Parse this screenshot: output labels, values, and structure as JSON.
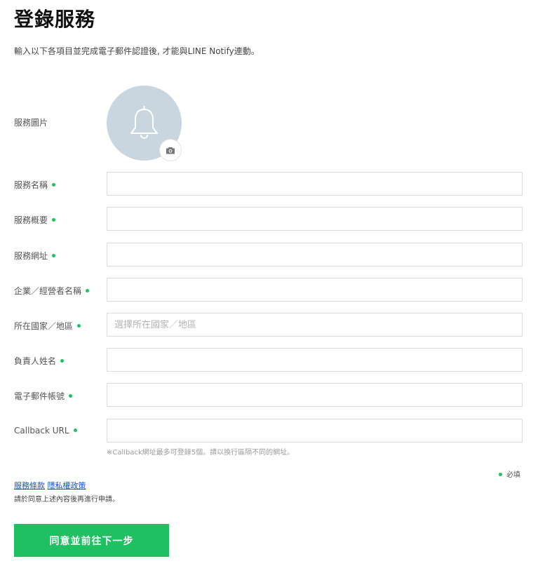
{
  "page": {
    "title": "登錄服務",
    "subtitle": "輸入以下各項目並完成電子郵件認證後, 才能與LINE Notify連動。"
  },
  "colors": {
    "accent": "#1ec061",
    "required_dot": "#1ec061",
    "avatar_bg": "#c9d6df",
    "link": "#1155cc"
  },
  "avatar": {
    "label": "服務圖片",
    "placeholder_icon": "bell-icon",
    "action_icon": "camera-icon"
  },
  "form": {
    "fields": [
      {
        "label": "服務名稱",
        "value": "",
        "placeholder": ""
      },
      {
        "label": "服務概要",
        "value": "",
        "placeholder": ""
      },
      {
        "label": "服務網址",
        "value": "",
        "placeholder": ""
      },
      {
        "label": "企業／經營者名稱",
        "value": "",
        "placeholder": ""
      },
      {
        "label": "所在國家／地區",
        "value": "",
        "placeholder": "選擇所在國家／地區"
      },
      {
        "label": "負責人姓名",
        "value": "",
        "placeholder": ""
      },
      {
        "label": "電子郵件帳號",
        "value": "",
        "placeholder": ""
      },
      {
        "label": "Callback URL",
        "value": "",
        "placeholder": ""
      }
    ],
    "callback_hint": "※Callback網址最多可登錄5個。請以換行區隔不同的網址。",
    "required_legend": "必填"
  },
  "footer": {
    "terms_link": "服務條款",
    "privacy_link": "隱私權政策",
    "consent_text": "請於同意上述內容後再進行申請。",
    "submit_label": "同意並前往下一步"
  }
}
